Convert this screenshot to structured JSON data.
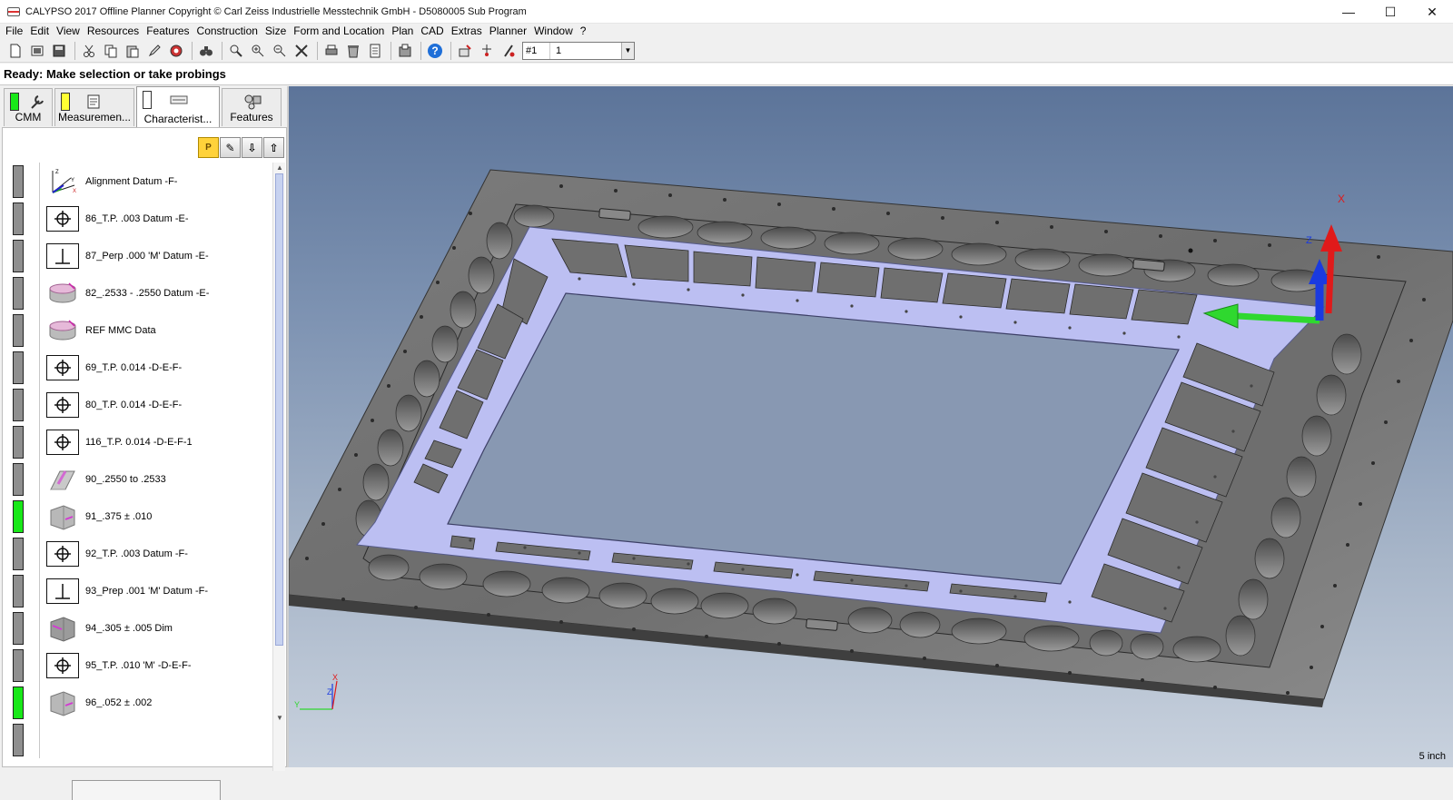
{
  "window": {
    "title": "CALYPSO 2017 Offline Planner Copyright © Carl Zeiss Industrielle Messtechnik GmbH - D5080005 Sub Program",
    "minimize": "—",
    "maximize": "☐",
    "close": "✕"
  },
  "menu": [
    "File",
    "Edit",
    "View",
    "Resources",
    "Features",
    "Construction",
    "Size",
    "Form and Location",
    "Plan",
    "CAD",
    "Extras",
    "Planner",
    "Window",
    "?"
  ],
  "toolbar": {
    "icons": [
      "new-icon",
      "open-icon",
      "save-icon",
      "cut-icon",
      "copy-icon",
      "paste-icon",
      "edit-icon",
      "undo-icon",
      "find-icon",
      "probe-icon",
      "probe-add-icon",
      "probe-remove-icon",
      "tools-icon",
      "print-icon",
      "delete-icon",
      "report-icon",
      "export-icon",
      "help-icon",
      "cmm-run-icon",
      "stylus-icon",
      "stylus-change-icon"
    ],
    "select_id": "#1",
    "select_value": "1"
  },
  "status": "Ready: Make selection or take probings",
  "tabs": [
    {
      "label": "CMM",
      "indicator": "#18e818"
    },
    {
      "label": "Measuremen...",
      "indicator": "#ffff33"
    },
    {
      "label": "Characterist...",
      "indicator": "#ffffff"
    },
    {
      "label": "Features",
      "indicator": ""
    }
  ],
  "mini_toolbar": {
    "p_label": "P"
  },
  "items": [
    {
      "label": "Alignment Datum -F-",
      "icon": "alignment-icon",
      "status": "gray"
    },
    {
      "label": "86_T.P. .003 Datum -E-",
      "icon": "true-position-icon",
      "status": "gray"
    },
    {
      "label": "87_Perp .000 'M' Datum -E-",
      "icon": "perpendicularity-icon",
      "status": "gray"
    },
    {
      "label": "82_.2533 - .2550 Datum -E-",
      "icon": "cylinder-diameter-icon",
      "status": "gray"
    },
    {
      "label": "REF MMC Data",
      "icon": "cylinder-diameter-icon",
      "status": "gray"
    },
    {
      "label": "69_T.P. 0.014 -D-E-F-",
      "icon": "true-position-icon",
      "status": "gray"
    },
    {
      "label": "80_T.P. 0.014 -D-E-F-",
      "icon": "true-position-icon",
      "status": "gray"
    },
    {
      "label": "116_T.P. 0.014 -D-E-F-1",
      "icon": "true-position-icon",
      "status": "gray"
    },
    {
      "label": "90_.2550 to .2533",
      "icon": "slot-width-icon",
      "status": "gray"
    },
    {
      "label": "91_.375 ± .010",
      "icon": "distance-icon",
      "status": "green"
    },
    {
      "label": "92_T.P. .003 Datum -F-",
      "icon": "true-position-icon",
      "status": "gray"
    },
    {
      "label": "93_Prep .001 'M' Datum -F-",
      "icon": "perpendicularity-icon",
      "status": "gray"
    },
    {
      "label": "94_.305 ± .005 Dim",
      "icon": "distance-icon",
      "status": "gray"
    },
    {
      "label": "95_T.P. .010 'M' -D-E-F-",
      "icon": "true-position-icon",
      "status": "gray"
    },
    {
      "label": "96_.052 ± .002",
      "icon": "distance-icon",
      "status": "green"
    }
  ],
  "viewport": {
    "scale_label": "5 inch",
    "axis_x": "X",
    "axis_y": "Y",
    "axis_z": "Z",
    "colors": {
      "x_axis": "#2fd82f",
      "z_axis": "#1a3ae0",
      "red_axis": "#e01a1a",
      "plate": "#6b6b6b",
      "frame": "#b9bcf2"
    }
  }
}
